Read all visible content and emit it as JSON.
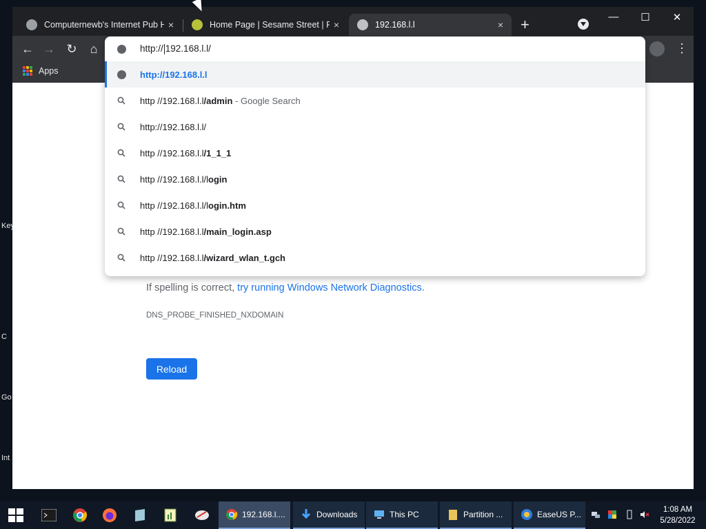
{
  "desktop": {
    "labels": [
      "Key",
      "C",
      "Go",
      "Int"
    ]
  },
  "tabs": [
    {
      "title": "Computernewb's Internet Pub Ho",
      "close": "×"
    },
    {
      "title": "Home Page | Sesame Street | PBS",
      "close": "×"
    },
    {
      "title": "192.168.l.l",
      "close": "×"
    }
  ],
  "window_controls": {
    "minimize": "—",
    "maximize": "☐",
    "close": "✕"
  },
  "toolbar": {
    "back": "←",
    "forward": "→",
    "reload": "↻",
    "home": "⌂",
    "menu": "⋮"
  },
  "bookmarks": {
    "apps_label": "Apps"
  },
  "omnibox": {
    "input_prefix": "http://",
    "input_suffix": "192.168.l.l/",
    "suggestions": [
      {
        "plain": "",
        "bold": "",
        "sel": "http://192.168.l.l",
        "suffix": "",
        "icon": "globe-icon"
      },
      {
        "plain": "http //192.168.l.l",
        "bold": "/admin",
        "suffix": " - Google Search",
        "icon": "search-icon"
      },
      {
        "plain": "http://192.168.l.l/",
        "bold": "",
        "suffix": "",
        "icon": "search-icon"
      },
      {
        "plain": "http //192.168.l.l",
        "bold": "/1_1_1",
        "suffix": "",
        "icon": "search-icon"
      },
      {
        "plain": "http //192.168.l.l/l",
        "bold": "ogin",
        "suffix": "",
        "icon": "search-icon"
      },
      {
        "plain": "http //192.168.l.l/l",
        "bold": "ogin.htm",
        "suffix": "",
        "icon": "search-icon"
      },
      {
        "plain": "http //192.168.l.l",
        "bold": "/main_login.asp",
        "suffix": "",
        "icon": "search-icon"
      },
      {
        "plain": "http //192.168.l.l",
        "bold": "/wizard_wlan_t.gch",
        "suffix": "",
        "icon": "search-icon"
      }
    ]
  },
  "page": {
    "hint_prefix": "If spelling is correct, ",
    "hint_link1": "try running",
    "hint_link2": "Windows Network Diagnostics",
    "hint_end": ".",
    "error_code": "DNS_PROBE_FINISHED_NXDOMAIN",
    "reload_label": "Reload"
  },
  "taskbar": {
    "tasks": [
      {
        "label": "192.168.l...."
      },
      {
        "label": "Downloads"
      },
      {
        "label": "This PC"
      },
      {
        "label": "Partition ..."
      },
      {
        "label": "EaseUS P..."
      }
    ],
    "time": "1:08 AM",
    "date": "5/28/2022"
  },
  "colors": {
    "accent": "#1a73e8",
    "tabstrip": "#202124",
    "toolbar": "#35363a",
    "taskbar": "#101826"
  }
}
